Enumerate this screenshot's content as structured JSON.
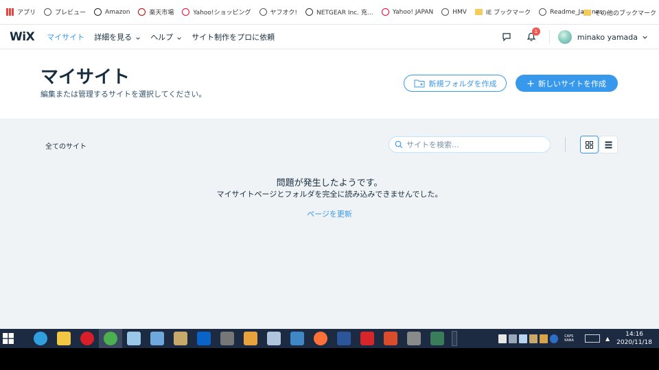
{
  "bookmarks": {
    "items": [
      {
        "label": "アプリ",
        "icon": "apps-grid-icon",
        "color": "#e8453c"
      },
      {
        "label": "プレビュー",
        "icon": "globe-icon",
        "color": "#555555"
      },
      {
        "label": "Amazon",
        "icon": "amazon-icon",
        "color": "#222222"
      },
      {
        "label": "楽天市場",
        "icon": "rakuten-icon",
        "color": "#bf0000"
      },
      {
        "label": "Yahoo!ショッピング",
        "icon": "yahoo-icon",
        "color": "#ff0033"
      },
      {
        "label": "ヤフオク!",
        "icon": "globe-icon",
        "color": "#555555"
      },
      {
        "label": "NETGEAR Inc. 充…",
        "icon": "netgear-icon",
        "color": "#333333"
      },
      {
        "label": "Yahoo! JAPAN",
        "icon": "yahoo-icon",
        "color": "#ff0033"
      },
      {
        "label": "HMV",
        "icon": "globe-icon",
        "color": "#555555"
      },
      {
        "label": "IE ブックマーク",
        "icon": "folder-icon",
        "color": "#f5cb5c"
      },
      {
        "label": "Readme_Japanes…",
        "icon": "globe-icon",
        "color": "#555555"
      }
    ],
    "more": "»",
    "other_label": "その他のブックマーク"
  },
  "header": {
    "logo": "WiX",
    "nav": [
      {
        "label": "マイサイト",
        "active": true,
        "dropdown": false
      },
      {
        "label": "詳細を見る",
        "active": false,
        "dropdown": true
      },
      {
        "label": "ヘルプ",
        "active": false,
        "dropdown": true
      },
      {
        "label": "サイト制作をプロに依頼",
        "active": false,
        "dropdown": false
      }
    ],
    "notification_count": "1",
    "user_name": "minako yamada"
  },
  "title_section": {
    "title": "マイサイト",
    "subtitle": "編集または管理するサイトを選択してください。",
    "new_folder_label": "新規フォルダを作成",
    "new_site_label": "新しいサイトを作成"
  },
  "content": {
    "all_sites_label": "全てのサイト",
    "search_placeholder": "サイトを検索...",
    "error_title": "問題が発生したようです。",
    "error_description": "マイサイトページとフォルダを完全に読み込みできませんでした。",
    "refresh_label": "ページを更新"
  },
  "taskbar": {
    "apps": [
      {
        "name": "ie",
        "color": "#2f9fe0"
      },
      {
        "name": "explorer",
        "color": "#f2c744"
      },
      {
        "name": "recorder",
        "color": "#d81e28"
      },
      {
        "name": "chrome",
        "color": "#4caf50",
        "active": true
      },
      {
        "name": "paint-tool",
        "color": "#9bc7e8"
      },
      {
        "name": "app-blue",
        "color": "#6fa8dc"
      },
      {
        "name": "paint",
        "color": "#c9a96a"
      },
      {
        "name": "outlook",
        "color": "#0a64c8"
      },
      {
        "name": "pen-tool",
        "color": "#777777"
      },
      {
        "name": "video",
        "color": "#e8a33d"
      },
      {
        "name": "image-tool",
        "color": "#b0c4de"
      },
      {
        "name": "app-grid",
        "color": "#3f88c5"
      },
      {
        "name": "firefox",
        "color": "#ff7139"
      },
      {
        "name": "word",
        "color": "#2b579a"
      },
      {
        "name": "acrobat",
        "color": "#d6262b"
      },
      {
        "name": "maple",
        "color": "#d94c2c"
      },
      {
        "name": "editor",
        "color": "#8a8a8a"
      },
      {
        "name": "camera",
        "color": "#3a7d5a"
      }
    ],
    "caps_line1": "CAPS",
    "caps_line2": "KANA",
    "time": "14:16",
    "date": "2020/11/18"
  },
  "colors": {
    "accent": "#3899ec",
    "text_dark": "#162d3d",
    "badge": "#ee5951"
  }
}
